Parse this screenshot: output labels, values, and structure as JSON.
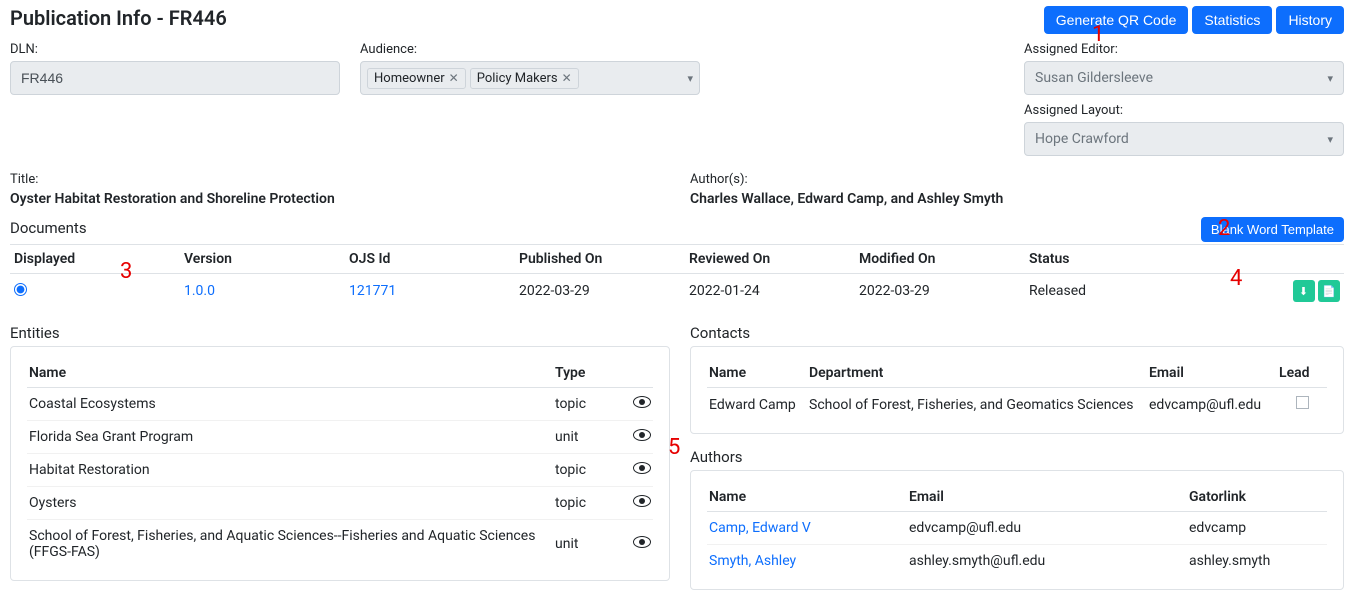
{
  "header": {
    "title": "Publication Info - FR446",
    "buttons": {
      "qr": "Generate QR Code",
      "stats": "Statistics",
      "history": "History"
    }
  },
  "fields": {
    "dln_label": "DLN:",
    "dln_value": "FR446",
    "audience_label": "Audience:",
    "audience_tags": [
      "Homeowner",
      "Policy Makers"
    ],
    "editor_label": "Assigned Editor:",
    "editor_value": "Susan Gildersleeve",
    "layout_label": "Assigned Layout:",
    "layout_value": "Hope Crawford",
    "title_label": "Title:",
    "title_value": "Oyster Habitat Restoration and Shoreline Protection",
    "authors_label": "Author(s):",
    "authors_value": "Charles Wallace, Edward Camp, and Ashley Smyth"
  },
  "documents": {
    "heading": "Documents",
    "blank_btn": "Blank Word Template",
    "cols": {
      "displayed": "Displayed",
      "version": "Version",
      "ojs": "OJS Id",
      "pub": "Published On",
      "rev": "Reviewed On",
      "mod": "Modified On",
      "status": "Status"
    },
    "row": {
      "version": "1.0.0",
      "ojs": "121771",
      "pub": "2022-03-29",
      "rev": "2022-01-24",
      "mod": "2022-03-29",
      "status": "Released"
    }
  },
  "entities": {
    "heading": "Entities",
    "cols": {
      "name": "Name",
      "type": "Type"
    },
    "rows": [
      {
        "name": "Coastal Ecosystems",
        "type": "topic"
      },
      {
        "name": "Florida Sea Grant Program",
        "type": "unit"
      },
      {
        "name": "Habitat Restoration",
        "type": "topic"
      },
      {
        "name": "Oysters",
        "type": "topic"
      },
      {
        "name": "School of Forest, Fisheries, and Aquatic Sciences--Fisheries and Aquatic Sciences (FFGS-FAS)",
        "type": "unit"
      }
    ]
  },
  "contacts": {
    "heading": "Contacts",
    "cols": {
      "name": "Name",
      "dept": "Department",
      "email": "Email",
      "lead": "Lead"
    },
    "rows": [
      {
        "name": "Edward Camp",
        "dept": "School of Forest, Fisheries, and Geomatics Sciences",
        "email": "edvcamp@ufl.edu"
      }
    ]
  },
  "authors": {
    "heading": "Authors",
    "cols": {
      "name": "Name",
      "email": "Email",
      "gator": "Gatorlink"
    },
    "rows": [
      {
        "name": "Camp, Edward V",
        "email": "edvcamp@ufl.edu",
        "gator": "edvcamp"
      },
      {
        "name": "Smyth, Ashley",
        "email": "ashley.smyth@ufl.edu",
        "gator": "ashley.smyth"
      }
    ]
  },
  "annotations": {
    "a1": "1",
    "a2": "2",
    "a3": "3",
    "a4": "4",
    "a5": "5"
  }
}
